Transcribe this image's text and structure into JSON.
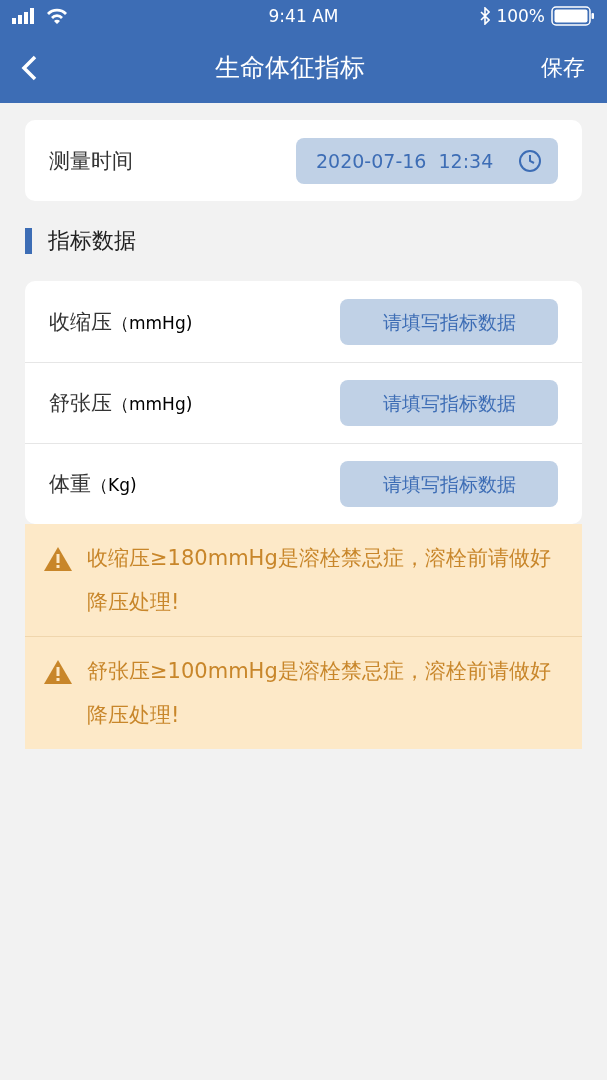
{
  "status_bar": {
    "time": "9:41 AM",
    "battery": "100%"
  },
  "nav": {
    "title": "生命体征指标",
    "action": "保存"
  },
  "measure_time": {
    "label": "测量时间",
    "value": "2020-07-16  12:34"
  },
  "section": {
    "title": "指标数据"
  },
  "fields": [
    {
      "label": "收缩压",
      "unit": "（mmHg)",
      "placeholder": "请填写指标数据"
    },
    {
      "label": "舒张压",
      "unit": "（mmHg)",
      "placeholder": "请填写指标数据"
    },
    {
      "label": "体重",
      "unit": "（Kg)",
      "placeholder": "请填写指标数据"
    }
  ],
  "warnings": [
    {
      "text": "收缩压≥180mmHg是溶栓禁忌症，溶栓前请做好降压处理!"
    },
    {
      "text": "舒张压≥100mmHg是溶栓禁忌症，溶栓前请做好降压处理!"
    }
  ]
}
